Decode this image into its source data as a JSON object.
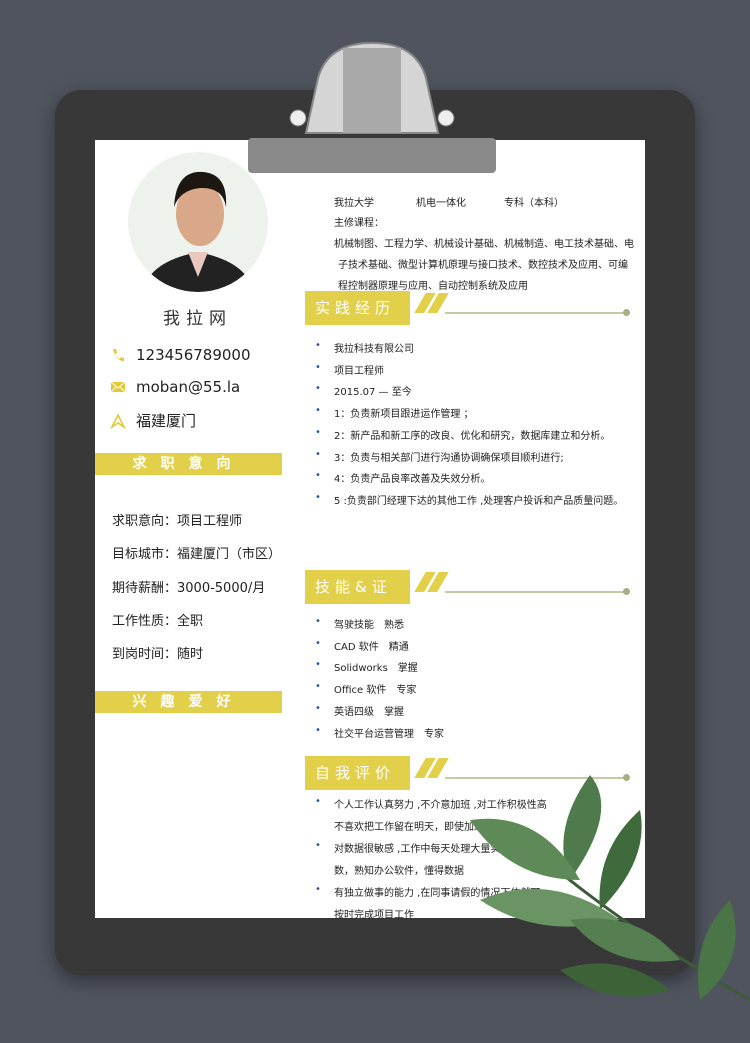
{
  "profile": {
    "name": "我拉网",
    "phone": "123456789000",
    "email": "moban@55.la",
    "location": "福建厦门"
  },
  "intention": {
    "title": "求职意向",
    "items": [
      "求职意向：项目工程师",
      "目标城市：福建厦门（市区）",
      "期待薪酬：3000-5000/月",
      "工作性质：全职",
      "到岗时间：随时"
    ]
  },
  "hobbies": {
    "title": "兴趣爱好"
  },
  "education": {
    "school": "我拉大学",
    "major": "机电一体化",
    "degree": "专科（本科）",
    "courses_label": "主修课程：",
    "courses": [
      "机械制图、工程力学、机械设计基础、机械制造、电工技术基础、电",
      "子技术基础、微型计算机原理与接口技术、数控技术及应用、可编",
      "程控制器原理与应用、自动控制系统及应用"
    ]
  },
  "experience": {
    "title": "实践经历",
    "items": [
      "我拉科技有限公司",
      "项目工程师",
      "2015.07 — 至今",
      "1：负责新项目跟进运作管理 ；",
      "2：新产品和新工序的改良、优化和研究，数据库建立和分析。",
      "3：负责与相关部门进行沟通协调确保项目顺利进行;",
      "4：负责产品良率改善及失效分析。",
      "5 :负责部门经理下达的其他工作 ,处理客户投诉和产品质量问题。"
    ]
  },
  "skills": {
    "title": "技能&证书",
    "items": [
      "驾驶技能　熟悉",
      "CAD 软件　精通",
      "Solidworks　掌握",
      "Office 软件　专家",
      "英语四级　掌握",
      "社交平台运营管理　专家"
    ]
  },
  "self": {
    "title": "自我评价",
    "lines": [
      "个人工作认真努力 ,不介意加班 ,对工作积极性高",
      "不喜欢把工作留在明天，即使加班也要完",
      "对数据很敏感 ,工作中每天处理大量实",
      "数，熟知办公软件，懂得数据",
      "有独立做事的能力 ,在同事请假的情况下依然可",
      "按时完成项目工作"
    ]
  },
  "colors": {
    "accent": "#e2d04a",
    "bullet": "#2a58a8",
    "background": "#4f545e"
  }
}
